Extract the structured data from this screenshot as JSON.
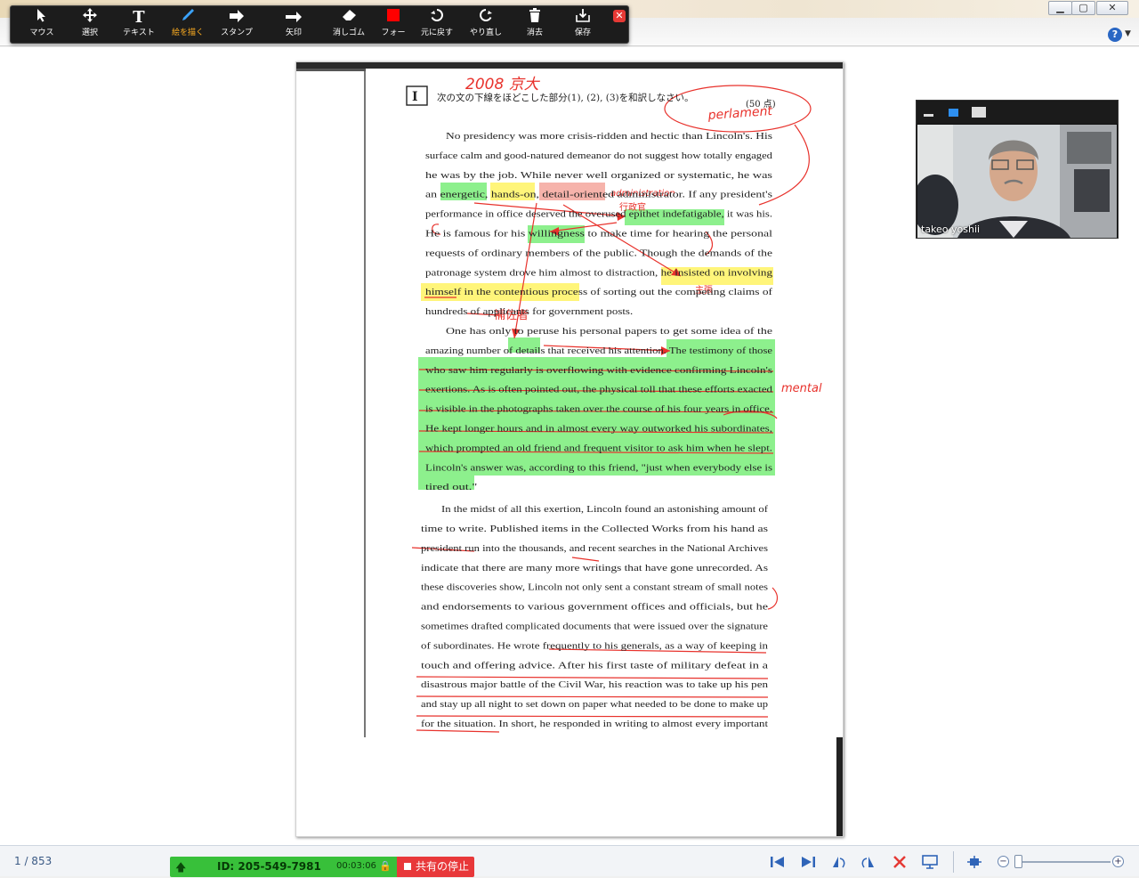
{
  "toolbar": {
    "tools": [
      {
        "label": "マウス",
        "icon": "cursor-icon"
      },
      {
        "label": "選択",
        "icon": "move-icon"
      },
      {
        "label": "テキスト",
        "icon": "text-icon"
      },
      {
        "label": "絵を描く",
        "icon": "pen-icon"
      },
      {
        "label": "スタンプ",
        "icon": "stamp-arrow-icon"
      },
      {
        "label": "矢印",
        "icon": "arrow-icon"
      },
      {
        "label": "消しゴム",
        "icon": "eraser-icon"
      },
      {
        "label": "フォー",
        "icon": "color-swatch-icon"
      },
      {
        "label": "元に戻す",
        "icon": "undo-icon"
      },
      {
        "label": "やり直し",
        "icon": "redo-icon"
      },
      {
        "label": "消去",
        "icon": "trash-icon"
      },
      {
        "label": "保存",
        "icon": "save-icon"
      }
    ],
    "active_tool": "絵を描く",
    "close": "✕"
  },
  "window": {
    "help": "?"
  },
  "video": {
    "participant_name": "takeo yoshii"
  },
  "document": {
    "header_note": "2008 京大",
    "section_label": "I",
    "instruction": "次の文の下線をほどこした部分(1), (2), (3)を和訳しなさい。",
    "points": "(50 点)",
    "annotations": {
      "parliament": "perlament",
      "admin": "administration",
      "gyousei": "行政官",
      "hosa": "補佐者",
      "mental": "mental",
      "shusai": "主張"
    },
    "lines": [
      "No presidency was more crisis-ridden and hectic than Lincoln's. His",
      "surface calm and good-natured demeanor do not suggest how totally engaged",
      "he was by the job. While never well organized or systematic, he was",
      "an energetic, hands-on, detail-oriented administrator. If any president's",
      "performance in office deserved the overused epithet indefatigable, it was his.",
      "He is famous for his willingness to make time for hearing the personal",
      "requests of ordinary members of the public. Though the demands of the",
      "patronage system drove him almost to distraction, he insisted on involving",
      "himself in the contentious process of sorting out the competing claims of",
      "hundreds of applicants for government posts.",
      "One has only to peruse his personal papers to get some idea of the",
      "amazing number of details that received his attention. The testimony of those",
      "who saw him regularly is overflowing with evidence confirming Lincoln's",
      "exertions. As is often pointed out, the physical toll that these efforts exacted",
      "is visible in the photographs taken over the course of his four years in office.",
      "He kept longer hours and in almost every way outworked his subordinates,",
      "which prompted an old friend and frequent visitor to ask him when he slept.",
      "Lincoln's answer was, according to this friend, \"just when everybody else is",
      "tired out.\"",
      "In the midst of all this exertion, Lincoln found an astonishing amount of",
      "time to write. Published items in the Collected Works from his hand as",
      "president run into the thousands, and recent searches in the National Archives",
      "indicate that there are many more writings that have gone unrecorded. As",
      "these discoveries show, Lincoln not only sent a constant stream of small notes",
      "and endorsements to various government offices and officials, but he",
      "sometimes drafted complicated documents that were issued over the signature",
      "of subordinates. He wrote frequently to his generals, as a way of keeping in",
      "touch and offering advice. After his first taste of military defeat in a",
      "disastrous major battle of the Civil War, his reaction was to take up his pen",
      "and stay up all night to set down on paper what needed to be done to make up",
      "for the situation. In short, he responded in writing to almost every important"
    ]
  },
  "status": {
    "page_counter": "1 / 853",
    "meeting_id": "ID: 205-549-7981",
    "elapsed": "00:03:06",
    "stop_share": "共有の停止"
  },
  "colors": {
    "highlight_green": "#8df08d",
    "highlight_yellow": "#fff57a",
    "highlight_pink": "#f6b3ab",
    "ink_red": "#e8322c",
    "share_green": "#38c03a",
    "stop_red": "#e8383a"
  }
}
